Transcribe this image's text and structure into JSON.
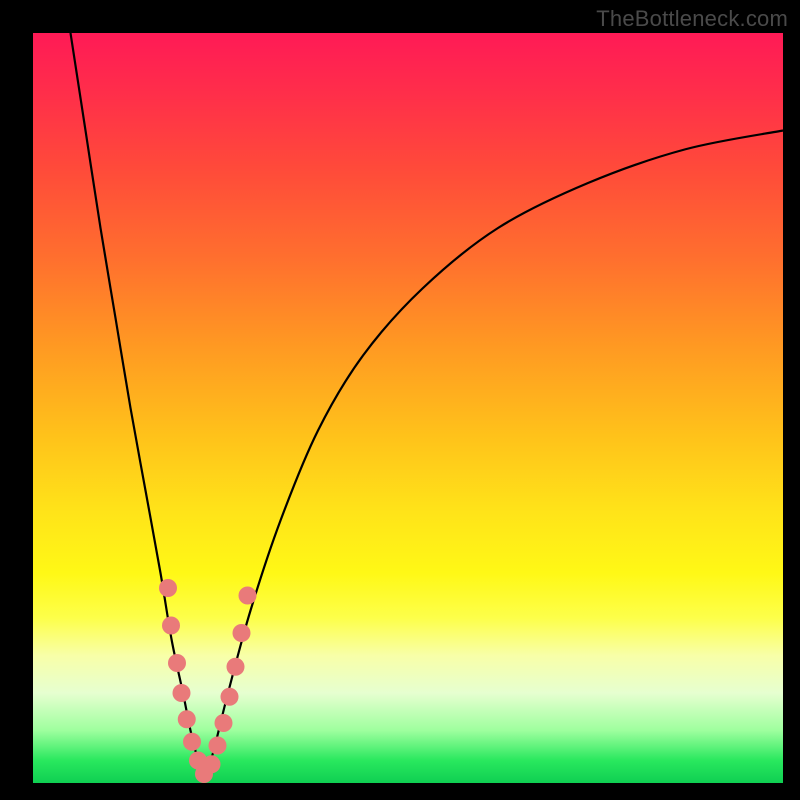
{
  "watermark": "TheBottleneck.com",
  "chart_data": {
    "type": "line",
    "title": "",
    "xlabel": "",
    "ylabel": "",
    "xlim": [
      0,
      100
    ],
    "ylim": [
      0,
      100
    ],
    "grid": false,
    "series": [
      {
        "name": "left-arm",
        "x": [
          5,
          7,
          9,
          11,
          13,
          15,
          17,
          18.5,
          20,
          21,
          22,
          22.8
        ],
        "y": [
          100,
          87,
          74,
          62,
          50,
          39,
          28,
          19,
          12,
          7,
          3,
          0.5
        ]
      },
      {
        "name": "right-arm",
        "x": [
          22.8,
          24,
          26,
          29,
          33,
          38,
          44,
          52,
          62,
          74,
          87,
          100
        ],
        "y": [
          0.5,
          4,
          12,
          23,
          35,
          47,
          57,
          66,
          74,
          80,
          84.5,
          87
        ]
      }
    ],
    "markers": {
      "name": "dots",
      "color": "#e97a7a",
      "radius_px": 9,
      "points": [
        {
          "x": 18.0,
          "y": 26
        },
        {
          "x": 18.4,
          "y": 21
        },
        {
          "x": 19.2,
          "y": 16
        },
        {
          "x": 19.8,
          "y": 12
        },
        {
          "x": 20.5,
          "y": 8.5
        },
        {
          "x": 21.2,
          "y": 5.5
        },
        {
          "x": 22.0,
          "y": 3.0
        },
        {
          "x": 22.8,
          "y": 1.2
        },
        {
          "x": 23.8,
          "y": 2.5
        },
        {
          "x": 24.6,
          "y": 5.0
        },
        {
          "x": 25.4,
          "y": 8.0
        },
        {
          "x": 26.2,
          "y": 11.5
        },
        {
          "x": 27.0,
          "y": 15.5
        },
        {
          "x": 27.8,
          "y": 20.0
        },
        {
          "x": 28.6,
          "y": 25.0
        }
      ]
    }
  }
}
